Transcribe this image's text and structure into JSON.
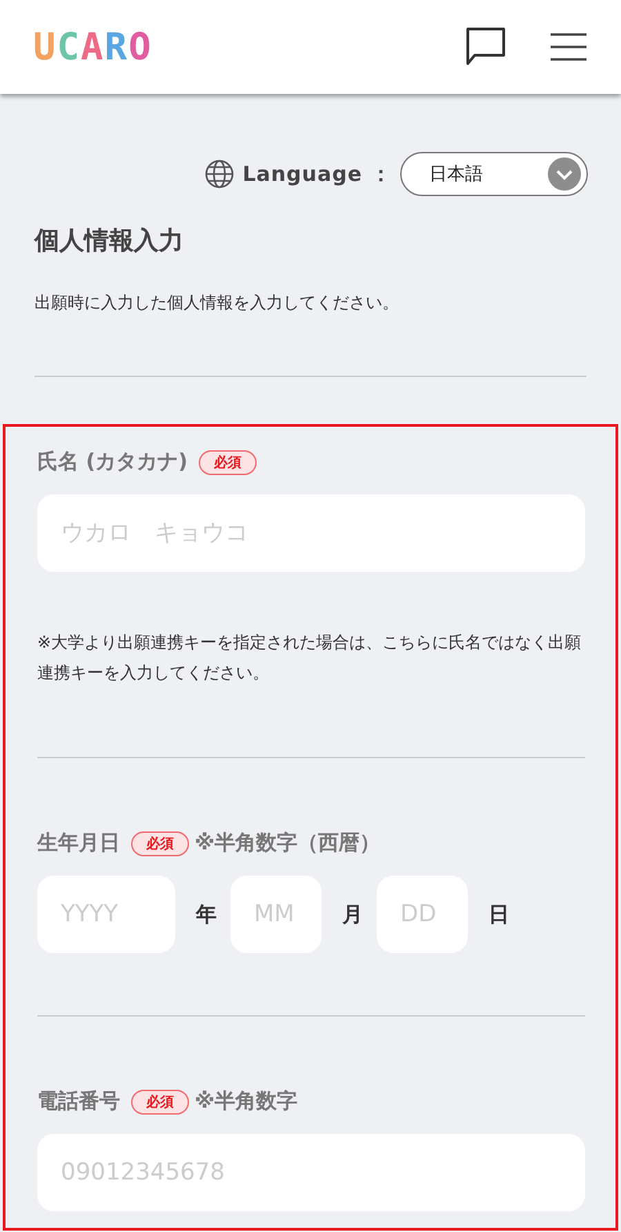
{
  "header": {
    "logo": [
      {
        "char": "U",
        "color": "#f4a261"
      },
      {
        "char": "C",
        "color": "#6cc5a8"
      },
      {
        "char": "A",
        "color": "#ee6b87"
      },
      {
        "char": "R",
        "color": "#5aa6e0"
      },
      {
        "char": "O",
        "color": "#e05ea0"
      }
    ]
  },
  "language": {
    "label": "Language",
    "separator": "：",
    "value": "日本語"
  },
  "title": "個人情報入力",
  "description": "出願時に入力した個人情報を入力してください。",
  "form": {
    "highlighted": true,
    "name_field": {
      "label": "氏名 (カタカナ)",
      "badge": "必須",
      "placeholder": "ウカロ　キョウコ",
      "note": "※大学より出願連携キーを指定された場合は、こちらに氏名ではなく出願連携キーを入力してください。"
    },
    "birth_field": {
      "label": "生年月日",
      "badge": "必須",
      "hint": "※半角数字（西暦）",
      "parts": [
        {
          "placeholder": "YYYY",
          "unit": "年",
          "kind": "wide"
        },
        {
          "placeholder": "MM",
          "unit": "月",
          "kind": "narrow"
        },
        {
          "placeholder": "DD",
          "unit": "日",
          "kind": "narrow"
        }
      ]
    },
    "phone_field": {
      "label": "電話番号",
      "badge": "必須",
      "hint": "※半角数字",
      "placeholder": "09012345678"
    }
  }
}
